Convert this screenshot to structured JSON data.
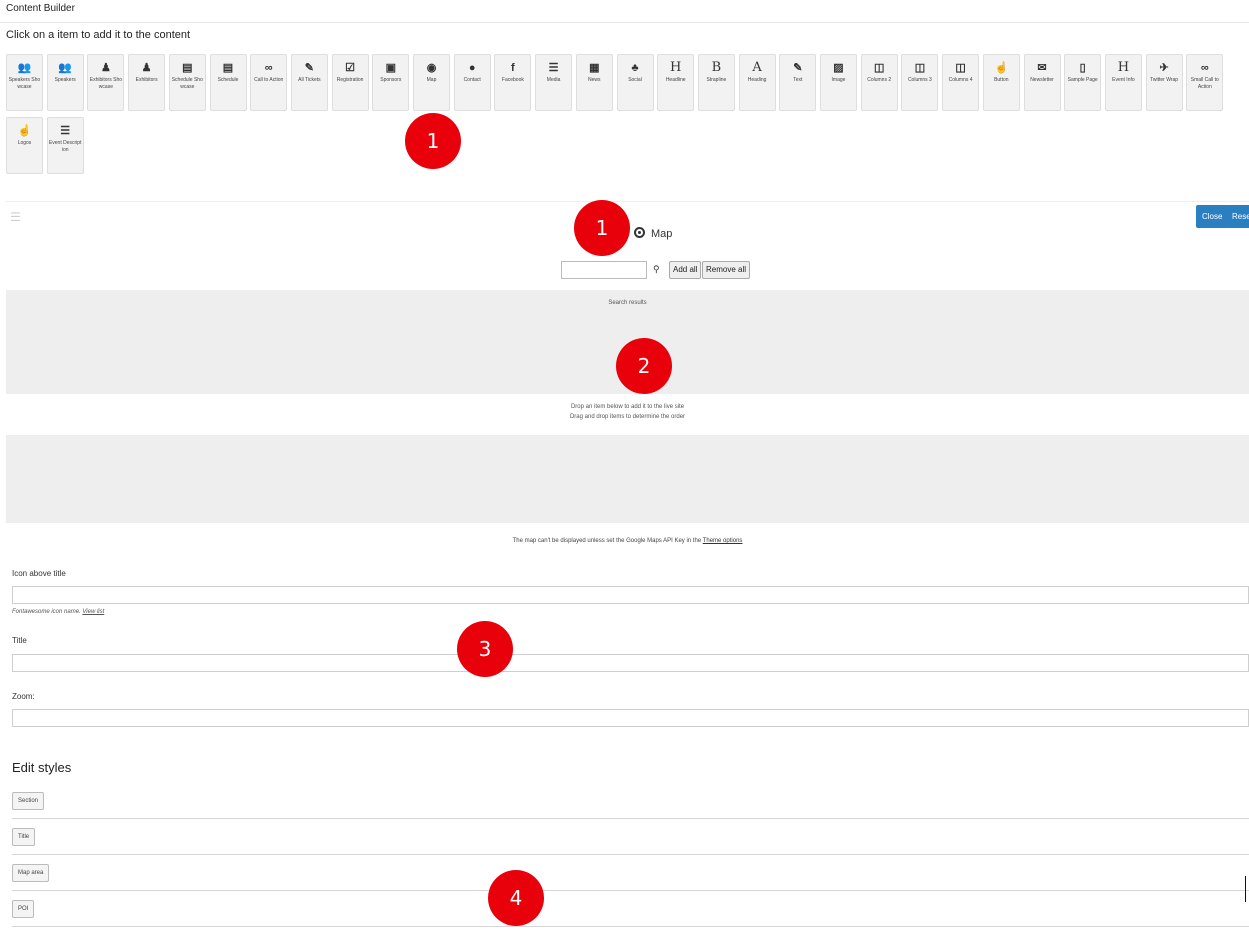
{
  "header": {
    "title": "Content Builder",
    "instruction": "Click on a item to add it to the content"
  },
  "palette": {
    "row1": [
      {
        "icon": "users-icon",
        "glyph": "👥",
        "label": "Speakers Sho wcase"
      },
      {
        "icon": "users-icon",
        "glyph": "👥",
        "label": "Speakers"
      },
      {
        "icon": "person-icon",
        "glyph": "♟",
        "label": "Exhibitors Sho wcase"
      },
      {
        "icon": "person-icon",
        "glyph": "♟",
        "label": "Exhibitors"
      },
      {
        "icon": "server-icon",
        "glyph": "▤",
        "label": "Schedule Sho wcase"
      },
      {
        "icon": "server-icon",
        "glyph": "▤",
        "label": "Schedule"
      },
      {
        "icon": "infinity-icon",
        "glyph": "∞",
        "label": "Call to Action"
      },
      {
        "icon": "ticket-icon",
        "glyph": "✎",
        "label": "All Tickets"
      },
      {
        "icon": "check-square-icon",
        "glyph": "☑",
        "label": "Registration"
      },
      {
        "icon": "money-icon",
        "glyph": "▣",
        "label": "Sponsors"
      },
      {
        "icon": "target-icon",
        "glyph": "◉",
        "label": "Map"
      },
      {
        "icon": "comment-icon",
        "glyph": "●",
        "label": "Contact"
      },
      {
        "icon": "facebook-icon",
        "glyph": "f",
        "label": "Facebook"
      },
      {
        "icon": "list-icon",
        "glyph": "☰",
        "label": "Media"
      },
      {
        "icon": "newspaper-icon",
        "glyph": "▦",
        "label": "News"
      },
      {
        "icon": "user-plus-icon",
        "glyph": "♣",
        "label": "Social"
      },
      {
        "icon": "header-icon",
        "glyph": "H",
        "label": "Headline"
      },
      {
        "icon": "bold-icon",
        "glyph": "B",
        "label": "Strapline"
      },
      {
        "icon": "font-icon",
        "glyph": "A",
        "label": "Heading"
      },
      {
        "icon": "pencil-icon",
        "glyph": "✎",
        "label": "Text"
      },
      {
        "icon": "image-icon",
        "glyph": "▨",
        "label": "Image"
      },
      {
        "icon": "columns-icon",
        "glyph": "◫",
        "label": "Columns 2"
      },
      {
        "icon": "columns-icon",
        "glyph": "◫",
        "label": "Columns 3"
      },
      {
        "icon": "columns-icon",
        "glyph": "◫",
        "label": "Columns 4"
      },
      {
        "icon": "hand-pointer-icon",
        "glyph": "☝",
        "label": "Button"
      },
      {
        "icon": "envelope-icon",
        "glyph": "✉",
        "label": "Newsletter"
      },
      {
        "icon": "file-icon",
        "glyph": "▯",
        "label": "Sample Page"
      },
      {
        "icon": "header-icon",
        "glyph": "H",
        "label": "Event Info"
      },
      {
        "icon": "twitter-icon",
        "glyph": "✈",
        "label": "Twitter Wrap"
      },
      {
        "icon": "infinity-icon",
        "glyph": "∞",
        "label": "Small Call to Action"
      }
    ],
    "row2": [
      {
        "icon": "hand-pointer-icon",
        "glyph": "☝",
        "label": "Logos"
      },
      {
        "icon": "list-icon",
        "glyph": "☰",
        "label": "Event Descript ion"
      }
    ]
  },
  "badges": [
    "1",
    "1",
    "2",
    "3",
    "4"
  ],
  "editor": {
    "close_label": "Close",
    "reset_label": "Rese",
    "component_title": "Map",
    "search_placeholder": "",
    "add_all_label": "Add all",
    "remove_all_label": "Remove all",
    "search_results_label": "Search results",
    "drop_hint_line1": "Drop an item below to add it to the live site",
    "drop_hint_line2": "Drag and drop items to determine the order",
    "map_note_prefix": "The map can't be displayed unless set the Google Maps API Key in the",
    "map_note_link": "Theme options"
  },
  "form": {
    "icon_label": "Icon above title",
    "icon_help_prefix": "Fontawesome icon name.",
    "icon_help_link": "View list",
    "title_label": "Title",
    "zoom_label": "Zoom:"
  },
  "styles": {
    "heading": "Edit styles",
    "buttons": [
      "Section",
      "Title",
      "Map area",
      "POI"
    ]
  }
}
